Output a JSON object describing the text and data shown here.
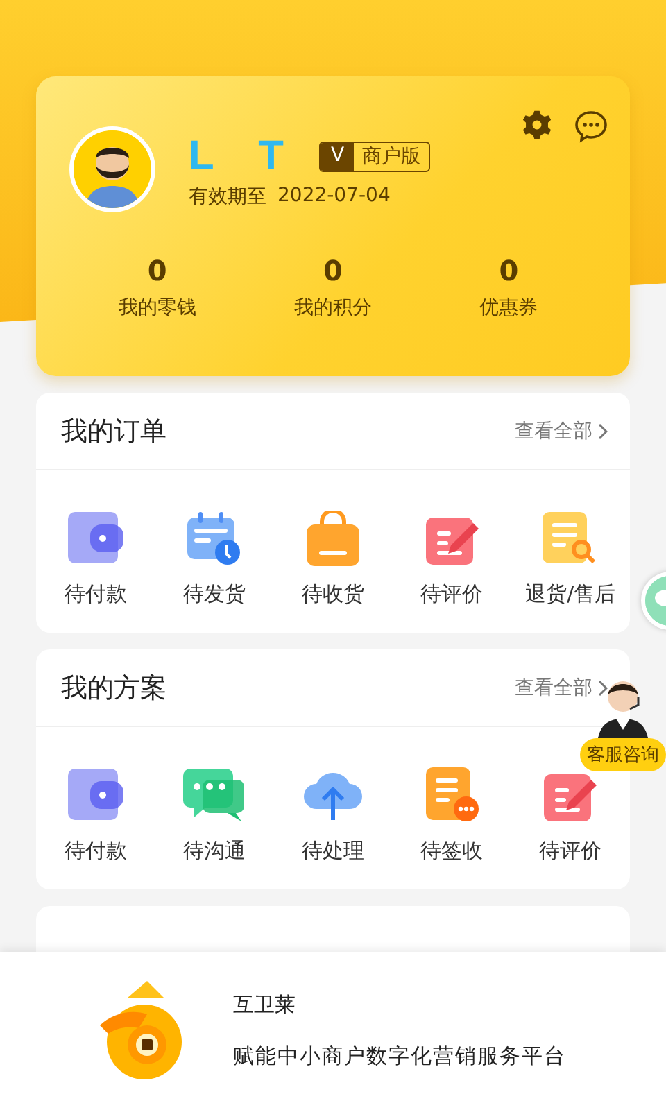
{
  "profile": {
    "name": "L T",
    "badge_letter": "V",
    "badge_label": "商户版",
    "expiry_label": "有效期至",
    "expiry_date": "2022-07-04",
    "stats": [
      {
        "value": "0",
        "label": "我的零钱"
      },
      {
        "value": "0",
        "label": "我的积分"
      },
      {
        "value": "0",
        "label": "优惠券"
      }
    ]
  },
  "sections": [
    {
      "title": "我的订单",
      "more": "查看全部",
      "items": [
        {
          "label": "待付款"
        },
        {
          "label": "待发货"
        },
        {
          "label": "待收货"
        },
        {
          "label": "待评价"
        },
        {
          "label": "退货/售后"
        }
      ]
    },
    {
      "title": "我的方案",
      "more": "查看全部",
      "items": [
        {
          "label": "待付款"
        },
        {
          "label": "待沟通"
        },
        {
          "label": "待处理"
        },
        {
          "label": "待签收"
        },
        {
          "label": "待评价"
        }
      ]
    }
  ],
  "support": {
    "label": "客服咨询"
  },
  "footer": {
    "app_name": "互卫莱",
    "slogan": "赋能中小商户数字化营销服务平台"
  }
}
